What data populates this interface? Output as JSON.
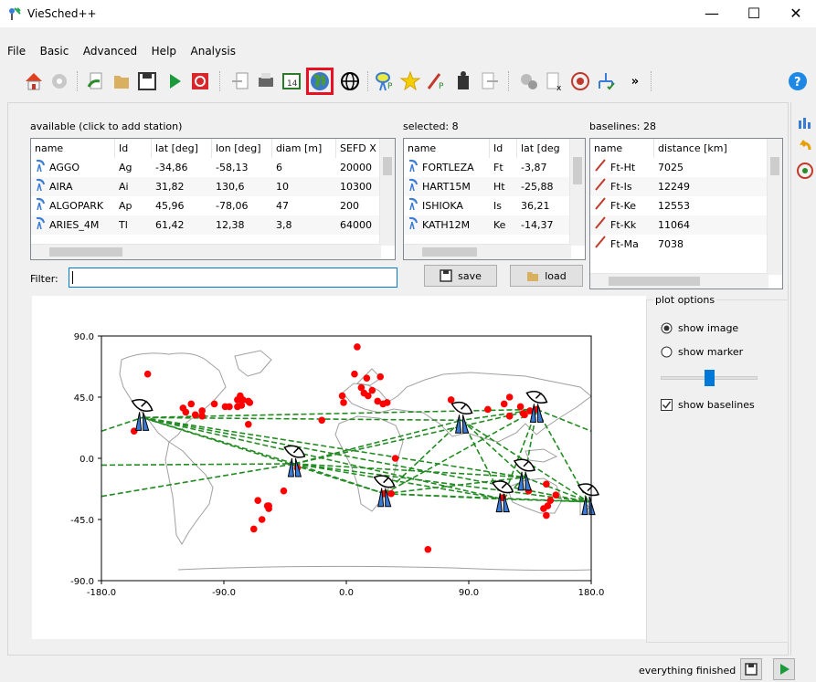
{
  "window": {
    "title": "VieSched++",
    "minimize": "—",
    "maximize": "☐",
    "close": "✕"
  },
  "menu": [
    "File",
    "Basic",
    "Advanced",
    "Help",
    "Analysis"
  ],
  "toolbar": {
    "overflow": "»",
    "help": "?"
  },
  "available": {
    "label": "available (click to add station)",
    "columns": [
      "name",
      "Id",
      "lat [deg]",
      "lon [deg]",
      "diam [m]",
      "SEFD X"
    ],
    "rows": [
      [
        "AGGO",
        "Ag",
        "-34,86",
        "-58,13",
        "6",
        "20000"
      ],
      [
        "AIRA",
        "Ai",
        "31,82",
        "130,6",
        "10",
        "10300"
      ],
      [
        "ALGOPARK",
        "Ap",
        "45,96",
        "-78,06",
        "47",
        "200"
      ],
      [
        "ARIES_4M",
        "Tl",
        "61,42",
        "12,38",
        "3,8",
        "64000"
      ]
    ]
  },
  "selected": {
    "label": "selected: 8",
    "columns": [
      "name",
      "Id",
      "lat [deg"
    ],
    "rows": [
      [
        "FORTLEZA",
        "Ft",
        "-3,87"
      ],
      [
        "HART15M",
        "Ht",
        "-25,88"
      ],
      [
        "ISHIOKA",
        "Is",
        "36,21"
      ],
      [
        "KATH12M",
        "Ke",
        "-14,37"
      ]
    ],
    "save": "save",
    "load": "load"
  },
  "baselines": {
    "label": "baselines: 28",
    "columns": [
      "name",
      "distance [km]"
    ],
    "rows": [
      [
        "Ft-Ht",
        "7025"
      ],
      [
        "Ft-Is",
        "12249"
      ],
      [
        "Ft-Ke",
        "12553"
      ],
      [
        "Ft-Kk",
        "11064"
      ],
      [
        "Ft-Ma",
        "7038"
      ]
    ]
  },
  "filter": {
    "label": "Filter:",
    "value": ""
  },
  "plot": {
    "yticks": [
      "90.0",
      "45.0",
      "0.0",
      "-45.0",
      "-90.0"
    ],
    "xticks": [
      "-180.0",
      "-90.0",
      "0.0",
      "90.0",
      "180.0"
    ],
    "marker_color": "#ff0000",
    "baseline_color": "#228b22",
    "land_color": "#a0a0a0"
  },
  "plot_options": {
    "title": "plot options",
    "show_image": "show image",
    "show_marker": "show marker",
    "show_baselines": "show baselines",
    "image_selected": true,
    "marker_size_fraction": 0.5
  },
  "status": {
    "text": "everything finished"
  },
  "accent": "#e81123"
}
